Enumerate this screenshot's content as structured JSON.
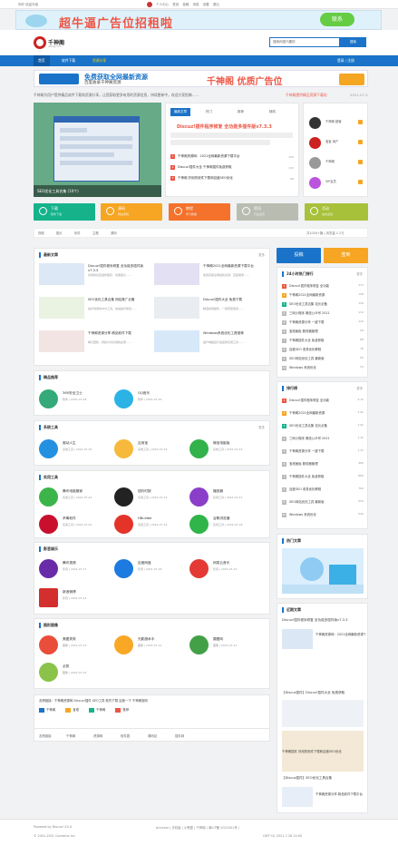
{
  "topbar": {
    "left": "你好 欢迎光临",
    "links": [
      "个人中心",
      "签到",
      "投稿",
      "消息",
      "设置",
      "退出"
    ]
  },
  "ad_top": {
    "text": "超牛逼广告位招租啦",
    "button": "联系"
  },
  "site": {
    "logo": "千神阁",
    "logo_sub": "qiansg.com"
  },
  "search": {
    "placeholder": "搜索你感兴趣的",
    "button": "搜索"
  },
  "nav": {
    "items": [
      "首页",
      "软件下载",
      "资源分享"
    ],
    "right": "登录 / 注册"
  },
  "ad_banner": {
    "line1": "免费获取全网最新资源",
    "line2": "百度收录干神阁资源",
    "big": "千神阁 优质广告位"
  },
  "notice": {
    "text": "千神阁为用户提供精品软件下载和资源分享，让您获取更多有用的资源信息，持续更新中，欢迎大家投稿……",
    "red": "千神阁提供精品资源下载站",
    "date": "2021-07-28"
  },
  "slider": {
    "caption": "SEO优化工具合集 (10个)"
  },
  "tabs": {
    "labels": [
      "最新文章",
      "热门",
      "推荐",
      "随机"
    ],
    "title": "Discuz!插件程序修复 全功能多插件版v7.3.3",
    "items": [
      {
        "n": "1",
        "t": "千神阁资源网：2021全网最新资源下载平台",
        "c": "155"
      },
      {
        "n": "2",
        "t": "Discuz!插件大全 千神阁插件免费获取",
        "c": "132"
      },
      {
        "n": "3",
        "t": "千神阁 好用的软件下载和百度SEO优化",
        "c": "98"
      }
    ]
  },
  "users": [
    {
      "name": "千神阁 超管",
      "sub": "发布 128"
    },
    {
      "name": "宝宝 用户",
      "sub": "发布 66"
    },
    {
      "name": "千神阁",
      "sub": "发布 25"
    },
    {
      "name": "VIP会员",
      "sub": "发布 12"
    }
  ],
  "categories": [
    {
      "t": "下载",
      "s": "软件下载"
    },
    {
      "t": "源码",
      "s": "网站源码"
    },
    {
      "t": "教程",
      "s": "学习教程"
    },
    {
      "t": "资讯",
      "s": "行业资讯"
    },
    {
      "t": "活动",
      "s": "站内活动"
    }
  ],
  "toolrow": [
    "视频",
    "图片",
    "软件",
    "主题",
    "源码"
  ],
  "toolrow_right": "共1000+篇  |  浏览量 1.2万",
  "latest": {
    "title": "最新文章",
    "more": "更多",
    "items": [
      {
        "t": "Discuz!插件程序修复 全功能多插件版v7.3.3",
        "d": "好用的社区插件程序，功能强大……"
      },
      {
        "t": "千神阁2021全网最新资源下载平台",
        "d": "免费获取全网最新资源，百度收录……"
      },
      {
        "t": "SEO优化工具合集 网站推广必备",
        "d": "站长常用的SEO工具，快速提升排名……"
      },
      {
        "t": "Discuz!插件大全 免费下载",
        "d": "精选常用插件，一键安装使用……"
      },
      {
        "t": "千神阁资源分享 精品软件下载",
        "d": "每日更新，持续分享好用的资源……"
      },
      {
        "t": "Windows系统优化工具推荐",
        "d": "提升电脑运行速度的实用工具……"
      }
    ]
  },
  "apps_recommend": {
    "title": "精品推荐",
    "items": [
      {
        "n": "360安全卫士",
        "d": "软件 | 2021-07-28"
      },
      {
        "n": "QQ音乐",
        "d": "软件 | 2021-07-26"
      }
    ]
  },
  "apps_system": {
    "title": "系统工具",
    "more": "更多",
    "items": [
      {
        "n": "驱动人生",
        "d": "系统工具 | 2021-07-25"
      },
      {
        "n": "应用宝",
        "d": "系统工具 | 2021-07-24"
      },
      {
        "n": "微信电脑版",
        "d": "系统工具 | 2021-07-23"
      }
    ]
  },
  "apps_tools": {
    "title": "实用工具",
    "items": [
      {
        "n": "腾讯电脑管家",
        "d": "实用工具 | 2021-07-22"
      },
      {
        "n": "纽约时报",
        "d": "实用工具 | 2021-07-22"
      },
      {
        "n": "播放器",
        "d": "实用工具 | 2021-07-21"
      },
      {
        "n": "杀毒软件",
        "d": "实用工具 | 2021-07-20"
      },
      {
        "n": "HBuilder",
        "d": "实用工具 | 2021-07-19"
      },
      {
        "n": "谷歌浏览器",
        "d": "实用工具 | 2021-07-18"
      }
    ]
  },
  "apps_media": {
    "title": "影音娱乐",
    "items": [
      {
        "n": "腾讯视频",
        "d": "影音 | 2021-07-17"
      },
      {
        "n": "百度网盘",
        "d": "影音 | 2021-07-16"
      },
      {
        "n": "网易云音乐",
        "d": "影音 | 2021-07-15"
      },
      {
        "n": "新浪微博",
        "d": "影音 | 2021-07-14"
      }
    ]
  },
  "apps_design": {
    "title": "图形图像",
    "items": [
      {
        "n": "美图秀秀",
        "d": "图像 | 2021-07-13"
      },
      {
        "n": "光影魔术手",
        "d": "图像 | 2021-07-12"
      },
      {
        "n": "摄图网",
        "d": "图像 | 2021-07-11"
      },
      {
        "n": "必剪",
        "d": "图像 | 2021-07-10"
      }
    ]
  },
  "linkrow": {
    "a": "友情链接：千神阁资源网  Discuz!插件  SEO工具  软件下载  百度一下  千神阁官网",
    "items": [
      "千神阁",
      "宝塔",
      "千神阁",
      "推荐"
    ]
  },
  "friend_links": [
    "友情链接",
    "千神阁",
    "资源网",
    "软件园",
    "源码站",
    "插件网"
  ],
  "sidebar": {
    "btn_post": "投稿",
    "btn_sign": "签到",
    "hot": {
      "title": "24小时热门排行",
      "more": "更多",
      "items": [
        {
          "t": "Discuz!插件程序修复 全功能",
          "c": "231"
        },
        {
          "t": "千神阁2021全网最新资源",
          "c": "198"
        },
        {
          "t": "SEO优化工具合集 站长必备",
          "c": "156"
        },
        {
          "t": "三网小程序 微信公众号 2021",
          "c": "132"
        },
        {
          "t": "千神阁资源分享 一键下载",
          "c": "120"
        },
        {
          "t": "宝塔面板 服务器管理",
          "c": "98"
        },
        {
          "t": "千神阁插件大全 免费获取",
          "c": "88"
        },
        {
          "t": "百度SEO 收录优化教程",
          "c": "76"
        },
        {
          "t": "SEO网站优化工具 最新版",
          "c": "65"
        },
        {
          "t": "Windows 系统优化",
          "c": "54"
        }
      ]
    },
    "top": {
      "title": "排行榜",
      "more": "更多",
      "items": [
        {
          "t": "Discuz!插件程序修复 全功能",
          "c": "2.1k"
        },
        {
          "t": "千神阁2021全网最新资源",
          "c": "1.9k"
        },
        {
          "t": "SEO优化工具合集 站长必备",
          "c": "1.6k"
        },
        {
          "t": "三网小程序 微信公众号 2021",
          "c": "1.3k"
        },
        {
          "t": "千神阁资源分享 一键下载",
          "c": "1.2k"
        },
        {
          "t": "宝塔面板 服务器管理",
          "c": "980"
        },
        {
          "t": "千神阁插件大全 免费获取",
          "c": "880"
        },
        {
          "t": "百度SEO 收录优化教程",
          "c": "760"
        },
        {
          "t": "SEO网站优化工具 最新版",
          "c": "650"
        },
        {
          "t": "Windows 系统优化",
          "c": "540"
        }
      ]
    },
    "image": {
      "title": "热门文章"
    },
    "recent": {
      "title": "近期文章",
      "items": [
        "Discuz!插件程序修复 全功能多插件版v7.3.3",
        "千神阁资源网：2021全网最新资源下载平台",
        "【Discuz插件】Discuz!插件大全 免费获取",
        "千神阁插件 好用的软件下载和百度SEO优化",
        "【Discuz插件】SEO优化工具合集",
        "千神阁资源分享 精品软件下载平台"
      ]
    }
  },
  "footer": {
    "powered": "Powered by Discuz! X3.4",
    "copy": "© 2001-2021 Comsenz Inc.",
    "links": "Archiver | 手机版 | 小黑屋 | 千神阁 ( 粤ICP备 2021001号 )",
    "right": "千神阁客服 QQ：123456789 | 工作时间 9:00-18:00",
    "time": "GMT+8, 2021-7-28 10:00"
  }
}
